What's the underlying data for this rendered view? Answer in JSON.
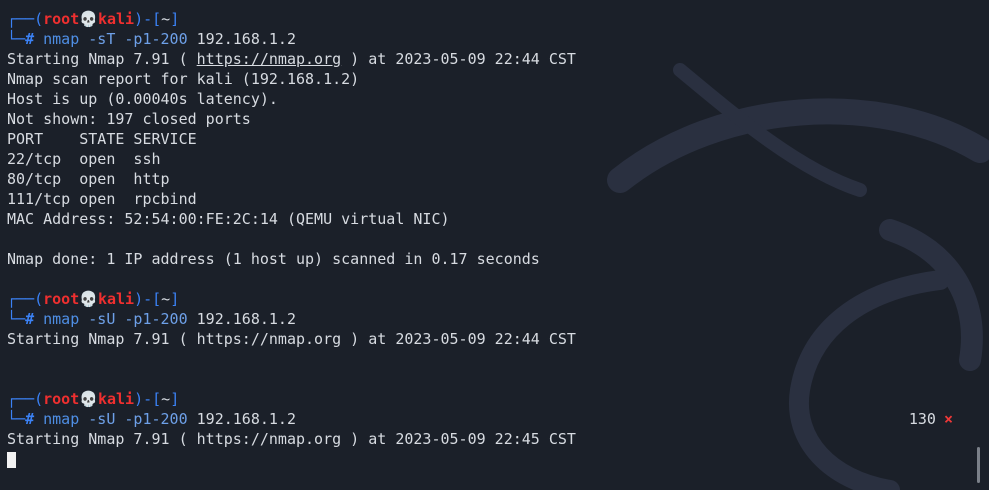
{
  "prompt": {
    "corner_top": "┌──(",
    "user": "root",
    "skull": "💀",
    "host": "kali",
    "mid": ")-[",
    "dir": "~",
    "close": "]",
    "corner_bottom": "└─",
    "hash": "#"
  },
  "blocks": [
    {
      "command": {
        "binary": "nmap",
        "args": "-sT -p1-200",
        "target": "192.168.1.2"
      },
      "output": {
        "starting_prefix": "Starting Nmap 7.91 ( ",
        "starting_url": "https://nmap.org",
        "starting_suffix": " ) at 2023-05-09 22:44 CST",
        "report": "Nmap scan report for kali (192.168.1.2)",
        "host_up": "Host is up (0.00040s latency).",
        "not_shown": "Not shown: 197 closed ports",
        "table_header": "PORT    STATE SERVICE",
        "ports": [
          "22/tcp  open  ssh",
          "80/tcp  open  http",
          "111/tcp open  rpcbind"
        ],
        "mac": "MAC Address: 52:54:00:FE:2C:14 (QEMU virtual NIC)",
        "done": "Nmap done: 1 IP address (1 host up) scanned in 0.17 seconds"
      }
    },
    {
      "command": {
        "binary": "nmap",
        "args": "-sU -p1-200",
        "target": "192.168.1.2"
      },
      "output": {
        "starting": "Starting Nmap 7.91 ( https://nmap.org ) at 2023-05-09 22:44 CST"
      }
    },
    {
      "command": {
        "binary": "nmap",
        "args": "-sU -p1-200",
        "target": "192.168.1.2"
      },
      "exit_code": "130",
      "exit_icon": "×",
      "output": {
        "starting": "Starting Nmap 7.91 ( https://nmap.org ) at 2023-05-09 22:45 CST"
      }
    }
  ],
  "colors": {
    "background": "#1b2029",
    "prompt_blue": "#3b82f6",
    "prompt_red": "#ef2f2f",
    "text": "#d7dbe1"
  }
}
